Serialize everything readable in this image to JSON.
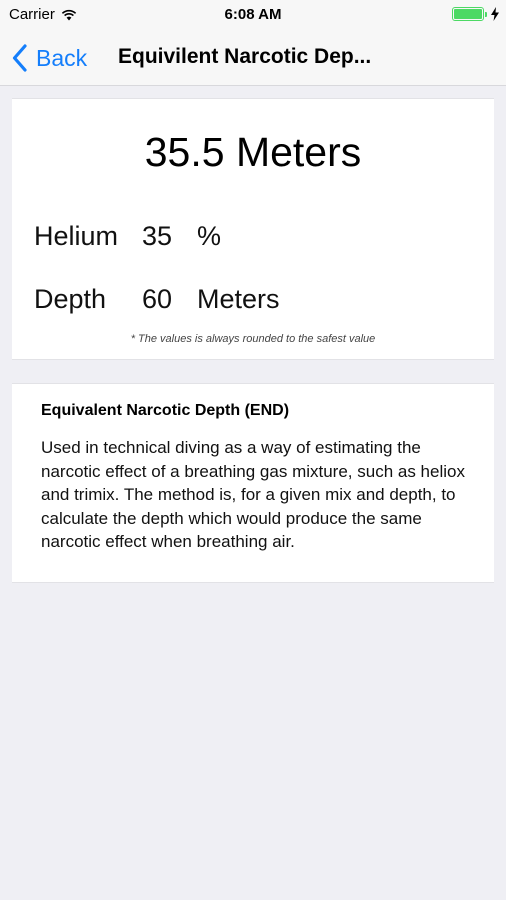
{
  "status": {
    "carrier": "Carrier",
    "time": "6:08 AM",
    "battery_level": 1.0
  },
  "nav": {
    "back_label": "Back",
    "title": "Equivilent Narcotic Dep..."
  },
  "result": {
    "value": "35.5 Meters",
    "helium_label": "Helium",
    "helium_value": "35",
    "helium_unit": "%",
    "depth_label": "Depth",
    "depth_value": "60",
    "depth_unit": "Meters",
    "footnote": "* The values is always rounded to the safest value"
  },
  "info": {
    "title": "Equivalent Narcotic Depth (END)",
    "body": "Used in technical diving as a way of estimating the narcotic effect of a breathing gas mixture, such as heliox and trimix. The method is, for a given mix and depth, to calculate the depth which would produce the same narcotic effect when breathing air."
  },
  "colors": {
    "accent": "#147efb",
    "battery": "#4cd964",
    "background": "#efeff4"
  }
}
